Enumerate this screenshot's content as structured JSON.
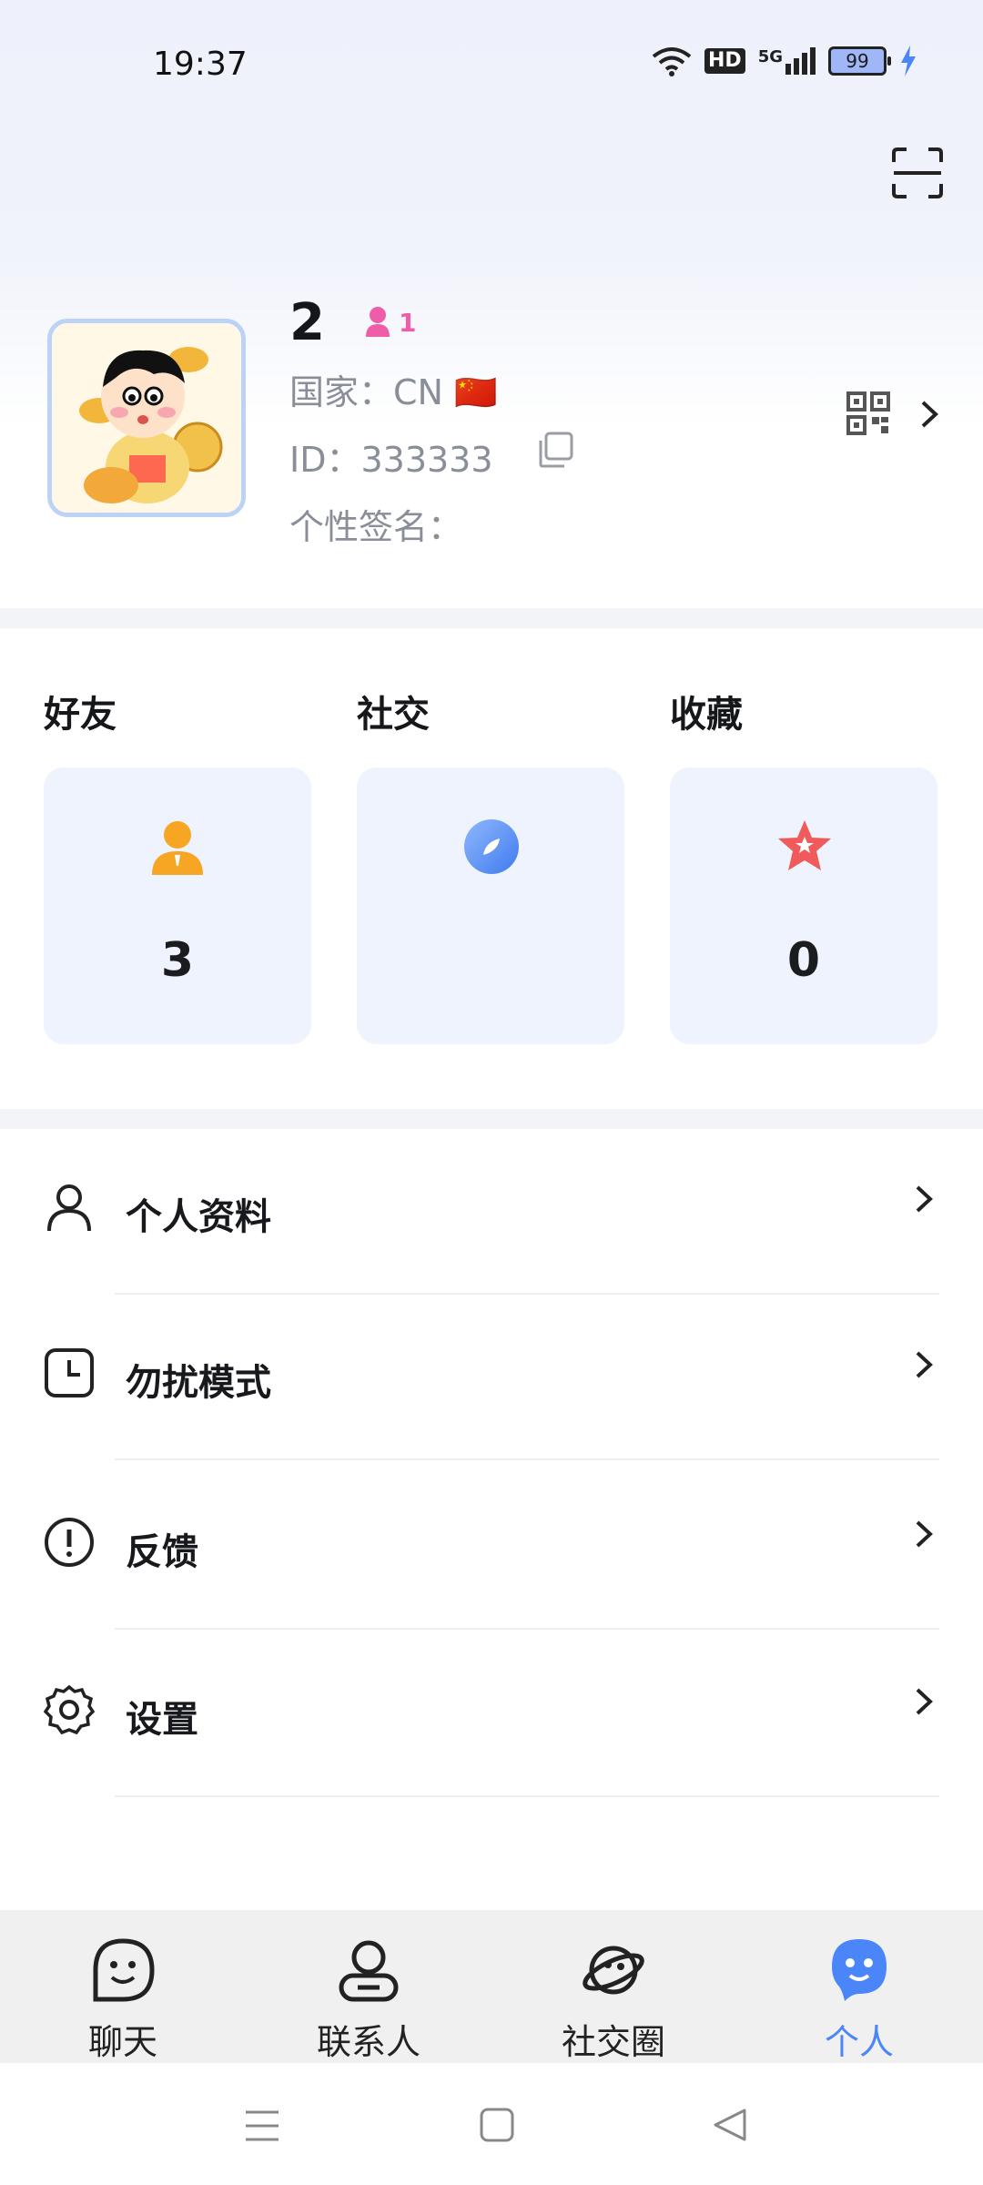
{
  "status": {
    "time": "19:37",
    "battery": "99",
    "hd": "HD",
    "net": "5G"
  },
  "profile": {
    "name": "2",
    "gender_count": "1",
    "country_label": "国家：",
    "country_value": "CN 🇨🇳",
    "id_label": "ID：",
    "id_value": "333333",
    "signature_label": "个性签名："
  },
  "sections": [
    {
      "label": "好友",
      "count": "3"
    },
    {
      "label": "社交",
      "count": ""
    },
    {
      "label": "收藏",
      "count": "0"
    }
  ],
  "menu": [
    {
      "label": "个人资料",
      "icon": "person-icon"
    },
    {
      "label": "勿扰模式",
      "icon": "clock-icon"
    },
    {
      "label": "反馈",
      "icon": "alert-icon"
    },
    {
      "label": "设置",
      "icon": "gear-icon"
    }
  ],
  "tabs": [
    {
      "label": "聊天",
      "icon": "smile-chat-icon"
    },
    {
      "label": "联系人",
      "icon": "contact-icon"
    },
    {
      "label": "社交圈",
      "icon": "planet-icon"
    },
    {
      "label": "个人",
      "icon": "user-active-icon",
      "active": true
    }
  ],
  "colors": {
    "accent": "#4a86f7",
    "card_bg": "#eef3fd",
    "gender_pink": "#ef5da8",
    "star_red": "#f05a5a",
    "orange": "#f6a623"
  }
}
